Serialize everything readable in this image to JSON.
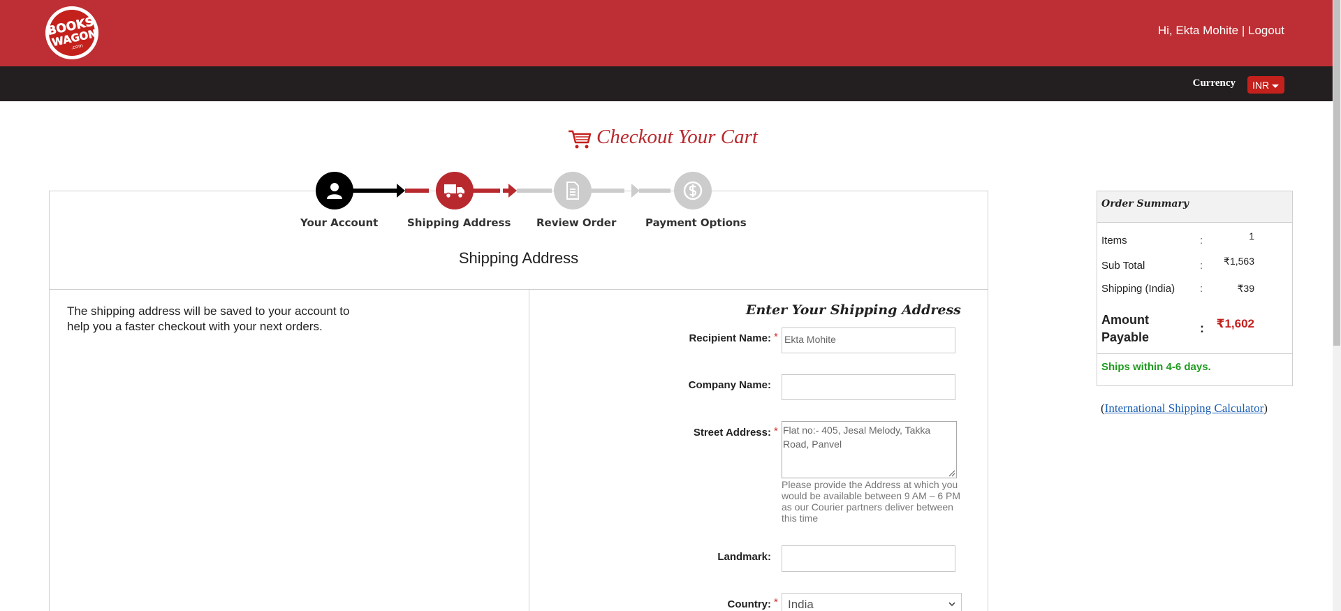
{
  "header": {
    "logo_alt": "BooksWagon.com",
    "logo_lines": [
      "BOOKS",
      "WAGON",
      ".com"
    ],
    "greeting": "Hi, Ekta Mohite",
    "separator": " | ",
    "logout_label": "Logout"
  },
  "subbar": {
    "currency_label": "Currency",
    "currency_value": "INR"
  },
  "page": {
    "title": "Checkout Your Cart",
    "section_heading": "Shipping Address",
    "info_text": "The shipping address will be saved to your account to help you a faster checkout with your next orders."
  },
  "steps": [
    {
      "label": "Your Account",
      "state": "done",
      "icon": "user-icon"
    },
    {
      "label": "Shipping Address",
      "state": "active",
      "icon": "truck-icon"
    },
    {
      "label": "Review Order",
      "state": "pending",
      "icon": "document-icon"
    },
    {
      "label": "Payment Options",
      "state": "pending",
      "icon": "dollar-icon"
    }
  ],
  "form": {
    "title": "Enter Your Shipping Address",
    "recipient_label": "Recipient Name:",
    "recipient_value": "Ekta Mohite",
    "company_label": "Company Name:",
    "company_value": "",
    "street_label": "Street Address:",
    "street_value": "Flat no:- 405, Jesal Melody, Takka Road, Panvel",
    "street_help": "Please provide the Address at which you would be available between 9 AM – 6 PM as our Courier partners deliver between this time",
    "landmark_label": "Landmark:",
    "landmark_value": "",
    "country_label": "Country:",
    "country_value": "India",
    "required_mark": "*"
  },
  "summary": {
    "title": "Order Summary",
    "items_label": "Items",
    "items_value": "1",
    "subtotal_label": "Sub Total",
    "subtotal_value": "₹1,563",
    "shipping_label": "Shipping (India)",
    "shipping_value": "₹39",
    "colon": ":",
    "amount_label": "Amount Payable",
    "amount_value": "₹1,602",
    "ships_note": "Ships within 4-6 days."
  },
  "calculator": {
    "open_paren": "(",
    "link_label": "International Shipping Calculator",
    "close_paren": ")"
  },
  "colors": {
    "brand_red": "#bd2f34",
    "dark_bar": "#231f20",
    "step_done": "#000000",
    "step_active": "#b8292e",
    "step_pending": "#cccccc",
    "success_green": "#1f9a1f"
  }
}
